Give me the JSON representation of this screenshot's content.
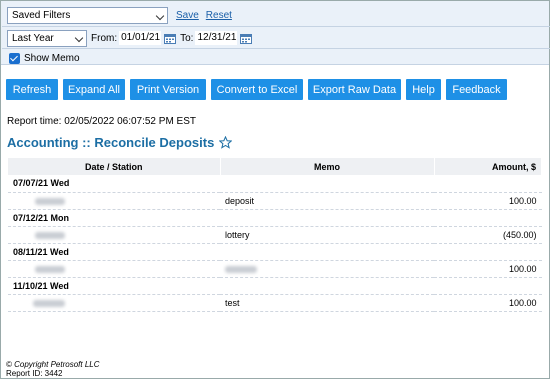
{
  "filters": {
    "saved_filters": "Saved Filters",
    "save": "Save",
    "reset": "Reset",
    "period": "Last Year",
    "from_label": "From:",
    "from": "01/01/21",
    "to_label": "To:",
    "to": "12/31/21",
    "show_memo": "Show Memo"
  },
  "toolbar": [
    "Refresh",
    "Expand All",
    "Print Version",
    "Convert to Excel",
    "Export Raw Data",
    "Help",
    "Feedback"
  ],
  "report_time": "Report time: 02/05/2022 06:07:52 PM EST",
  "title": "Accounting :: Reconcile Deposits",
  "table": {
    "headers": [
      "Date / Station",
      "Memo",
      "Amount, $"
    ],
    "groups": [
      {
        "date": "07/07/21 Wed",
        "memo": "deposit",
        "amount": "100.00"
      },
      {
        "date": "07/12/21 Mon",
        "memo": "lottery",
        "amount": "(450.00)"
      },
      {
        "date": "08/11/21 Wed",
        "memo": "",
        "amount": "100.00"
      },
      {
        "date": "11/10/21 Wed",
        "memo": "test",
        "amount": "100.00"
      }
    ]
  },
  "footer": {
    "copyright": "© Copyright Petrosoft LLC",
    "report_id": "Report ID: 3442"
  }
}
